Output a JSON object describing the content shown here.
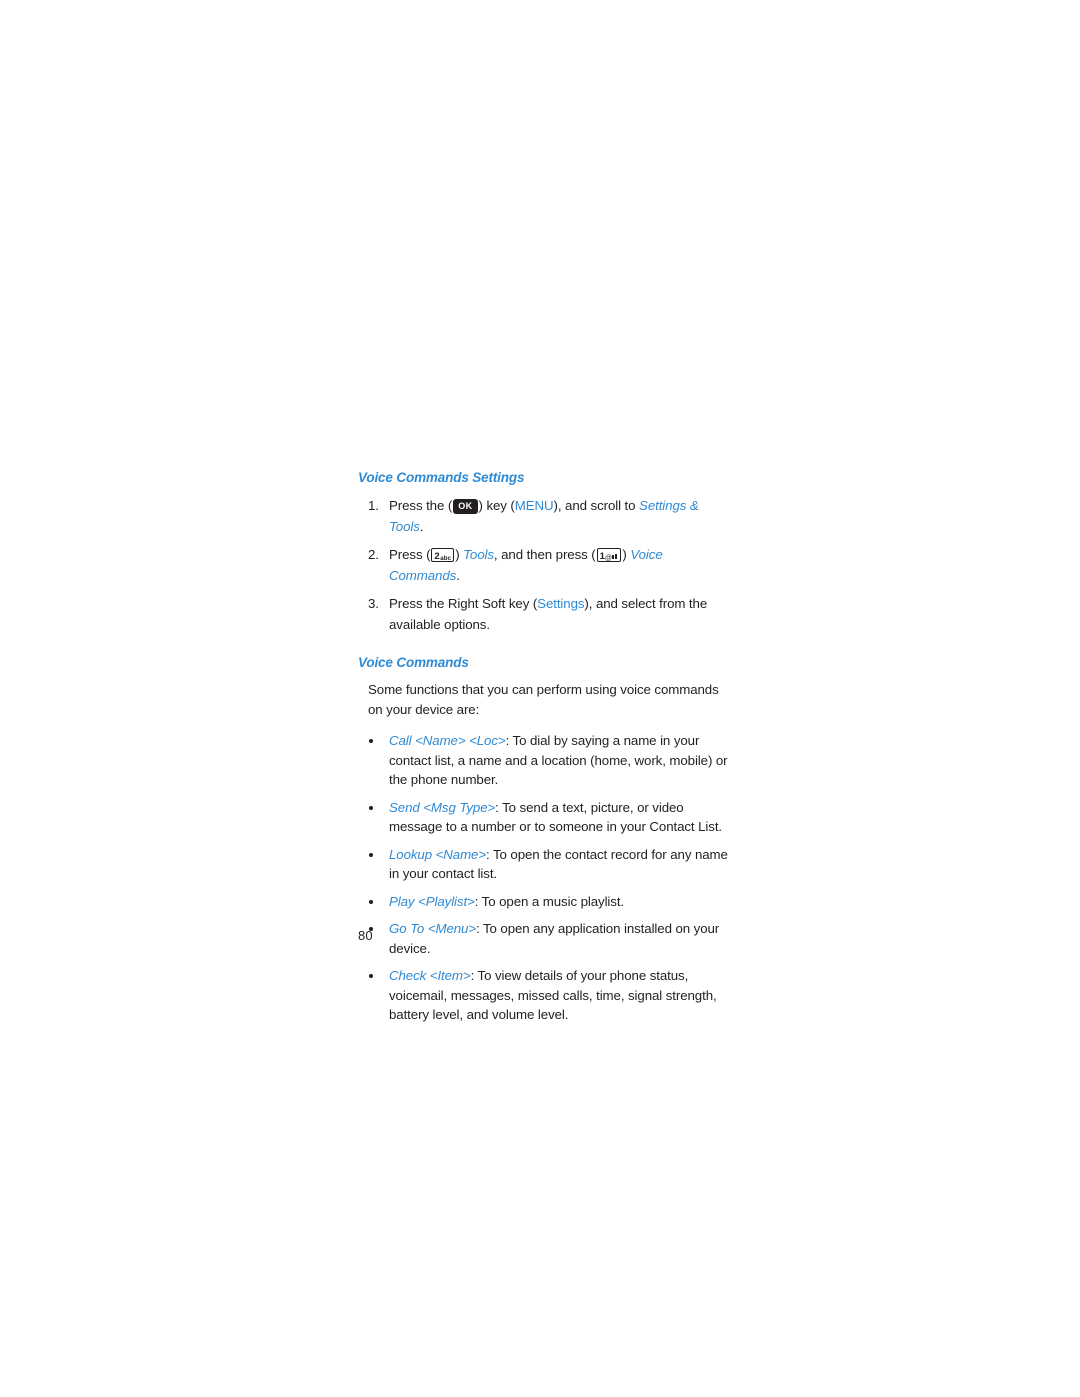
{
  "page": {
    "number": "80",
    "accent_color": "#2f8ad4",
    "text_color": "#231f20"
  },
  "sections": [
    {
      "heading": "Voice Commands Settings",
      "steps": [
        {
          "number": "1.",
          "parts": {
            "t1": "Press the (",
            "key": "OK",
            "t2": ") key (",
            "link1": "MENU",
            "t3": "), and scroll to ",
            "link2": "Settings & Tools",
            "t4": "."
          }
        },
        {
          "number": "2.",
          "parts": {
            "t1": "Press (",
            "key1_big": "2",
            "key1_small": "abc",
            "t2": ") ",
            "link1": "Tools",
            "t3": ", and then press (",
            "key2_big": "1",
            "key2_at": "@",
            "t4": ") ",
            "link2": "Voice Commands",
            "t5": "."
          }
        },
        {
          "number": "3.",
          "parts": {
            "t1": "Press the Right Soft key (",
            "link1": "Settings",
            "t2": "), and select from the available options."
          }
        }
      ]
    },
    {
      "heading": "Voice Commands",
      "intro": "Some functions that you can perform using voice commands on your device are:",
      "bullets": [
        {
          "term": "Call <Name> <Loc>",
          "description": ": To dial by saying a name in your contact list, a name and a location (home, work, mobile) or the phone number."
        },
        {
          "term": "Send <Msg Type>",
          "description": ": To send a text, picture, or video message to a number or to someone in your Contact List."
        },
        {
          "term": "Lookup <Name>",
          "description": ": To open the contact record for any name in your contact list."
        },
        {
          "term": "Play <Playlist>",
          "description": ": To open a music playlist."
        },
        {
          "term": "Go To <Menu>",
          "description": ": To open any application installed on your device."
        },
        {
          "term": "Check <Item>",
          "description": ": To view details of your phone status, voicemail, messages, missed calls, time, signal strength, battery level, and volume level."
        }
      ]
    }
  ]
}
